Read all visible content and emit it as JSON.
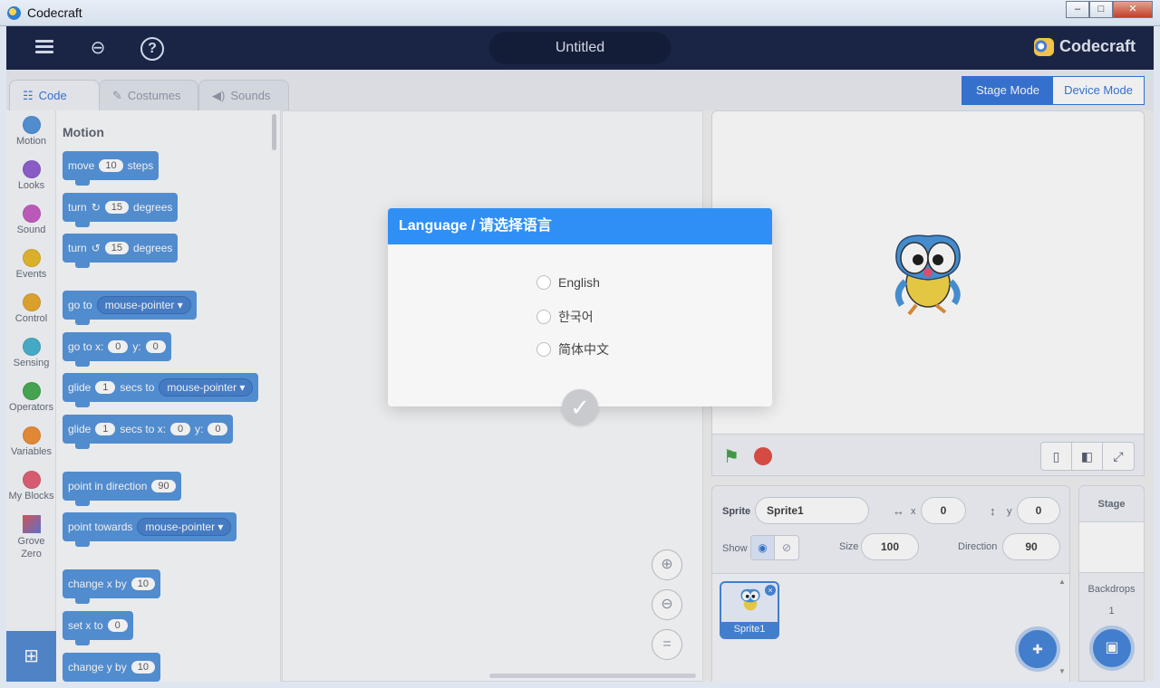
{
  "window": {
    "title": "Codecraft",
    "min": "–",
    "max": "□",
    "close": "✕"
  },
  "app_bar": {
    "project_title": "Untitled",
    "brand": "Codecraft"
  },
  "tabs": [
    {
      "label": "Code",
      "icon": "code-icon"
    },
    {
      "label": "Costumes",
      "icon": "brush-icon"
    },
    {
      "label": "Sounds",
      "icon": "speaker-icon"
    }
  ],
  "modes": {
    "stage": "Stage Mode",
    "device": "Device Mode"
  },
  "categories": [
    {
      "label": "Motion",
      "color": "#4c8fd9"
    },
    {
      "label": "Looks",
      "color": "#8a57cf"
    },
    {
      "label": "Sound",
      "color": "#c455c1"
    },
    {
      "label": "Events",
      "color": "#e6b820"
    },
    {
      "label": "Control",
      "color": "#e6a624"
    },
    {
      "label": "Sensing",
      "color": "#3fb0cc"
    },
    {
      "label": "Operators",
      "color": "#3da84a"
    },
    {
      "label": "Variables",
      "color": "#ef8a2a"
    },
    {
      "label": "My Blocks",
      "color": "#e2576e"
    },
    {
      "label": "Grove Zero",
      "color": "#6a6fd6"
    }
  ],
  "palette": {
    "title": "Motion",
    "blocks": {
      "move": {
        "a": "move",
        "v": "10",
        "b": "steps"
      },
      "turn_right": {
        "a": "turn",
        "v": "15",
        "b": "degrees"
      },
      "turn_left": {
        "a": "turn",
        "v": "15",
        "b": "degrees"
      },
      "goto": {
        "a": "go to",
        "d": "mouse-pointer"
      },
      "goto_xy": {
        "a": "go to x:",
        "x": "0",
        "y_label": "y:",
        "y": "0"
      },
      "glide_to": {
        "a": "glide",
        "v": "1",
        "b": "secs to",
        "d": "mouse-pointer"
      },
      "glide_xy": {
        "a": "glide",
        "v": "1",
        "b": "secs to x:",
        "x": "0",
        "y_label": "y:",
        "y": "0"
      },
      "point_dir": {
        "a": "point in direction",
        "v": "90"
      },
      "point_towards": {
        "a": "point towards",
        "d": "mouse-pointer"
      },
      "change_x": {
        "a": "change x by",
        "v": "10"
      },
      "set_x": {
        "a": "set x to",
        "v": "0"
      },
      "change_y": {
        "a": "change y by",
        "v": "10"
      }
    }
  },
  "sprite_info": {
    "sprite_label": "Sprite",
    "sprite_name": "Sprite1",
    "x_label": "x",
    "x": "0",
    "y_label": "y",
    "y": "0",
    "show_label": "Show",
    "size_label": "Size",
    "size": "100",
    "direction_label": "Direction",
    "direction": "90"
  },
  "sprites": [
    {
      "name": "Sprite1"
    }
  ],
  "stage_panel": {
    "title": "Stage",
    "backdrops_label": "Backdrops",
    "backdrops_count": "1"
  },
  "dialog": {
    "title": "Language / 请选择语言",
    "options": [
      "English",
      "한국어",
      "简体中文"
    ],
    "confirm_icon": "checkmark-icon"
  }
}
